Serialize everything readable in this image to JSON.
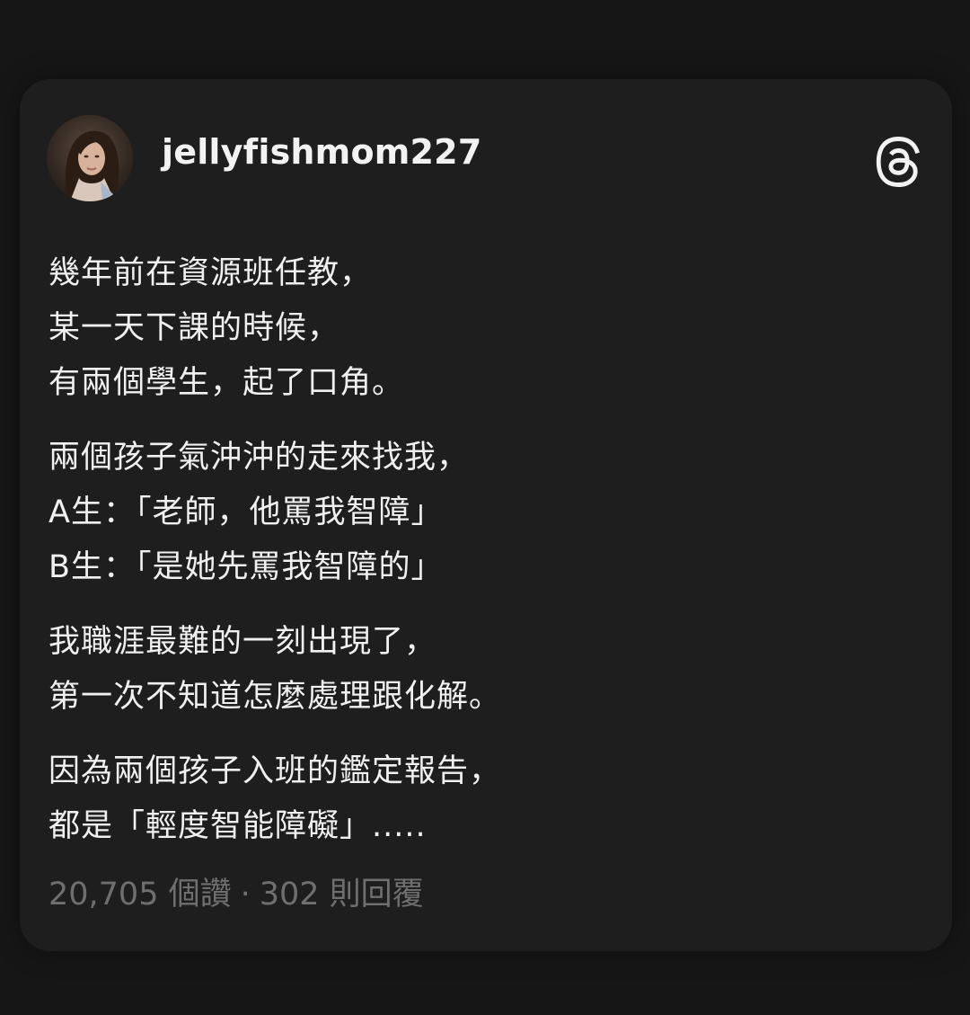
{
  "post": {
    "username": "jellyfishmom227",
    "paragraphs": [
      {
        "lines": [
          "幾年前在資源班任教，",
          "某一天下課的時候，",
          "有兩個學生，起了口角。"
        ]
      },
      {
        "lines": [
          "兩個孩子氣沖沖的走來找我，",
          "A生：「老師，他罵我智障」",
          "B生：「是她先罵我智障的」"
        ]
      },
      {
        "lines": [
          "我職涯最難的一刻出現了，",
          "第一次不知道怎麼處理跟化解。"
        ]
      },
      {
        "lines": [
          "因為兩個孩子入班的鑑定報告，",
          "都是「輕度智能障礙」....."
        ]
      }
    ],
    "likes": "20,705 個讚",
    "separator": "·",
    "replies": "302 則回覆"
  },
  "icons": {
    "avatar": "user-avatar-photo",
    "app": "threads-logo-icon"
  },
  "colors": {
    "background": "#161616",
    "card": "#1e1e1e",
    "text": "#f0f0f0",
    "muted": "#6f6f6f"
  }
}
